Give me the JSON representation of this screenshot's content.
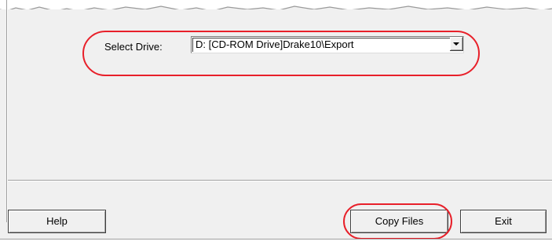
{
  "colors": {
    "dialog_bg": "#f0f0f0",
    "highlight": "#e8202a"
  },
  "drive": {
    "label": "Select Drive:",
    "selected": "D: [CD-ROM Drive]Drake10\\Export",
    "dropdown_icon": "chevron-down-icon"
  },
  "buttons": {
    "help": "Help",
    "copy_files": "Copy Files",
    "exit": "Exit"
  }
}
